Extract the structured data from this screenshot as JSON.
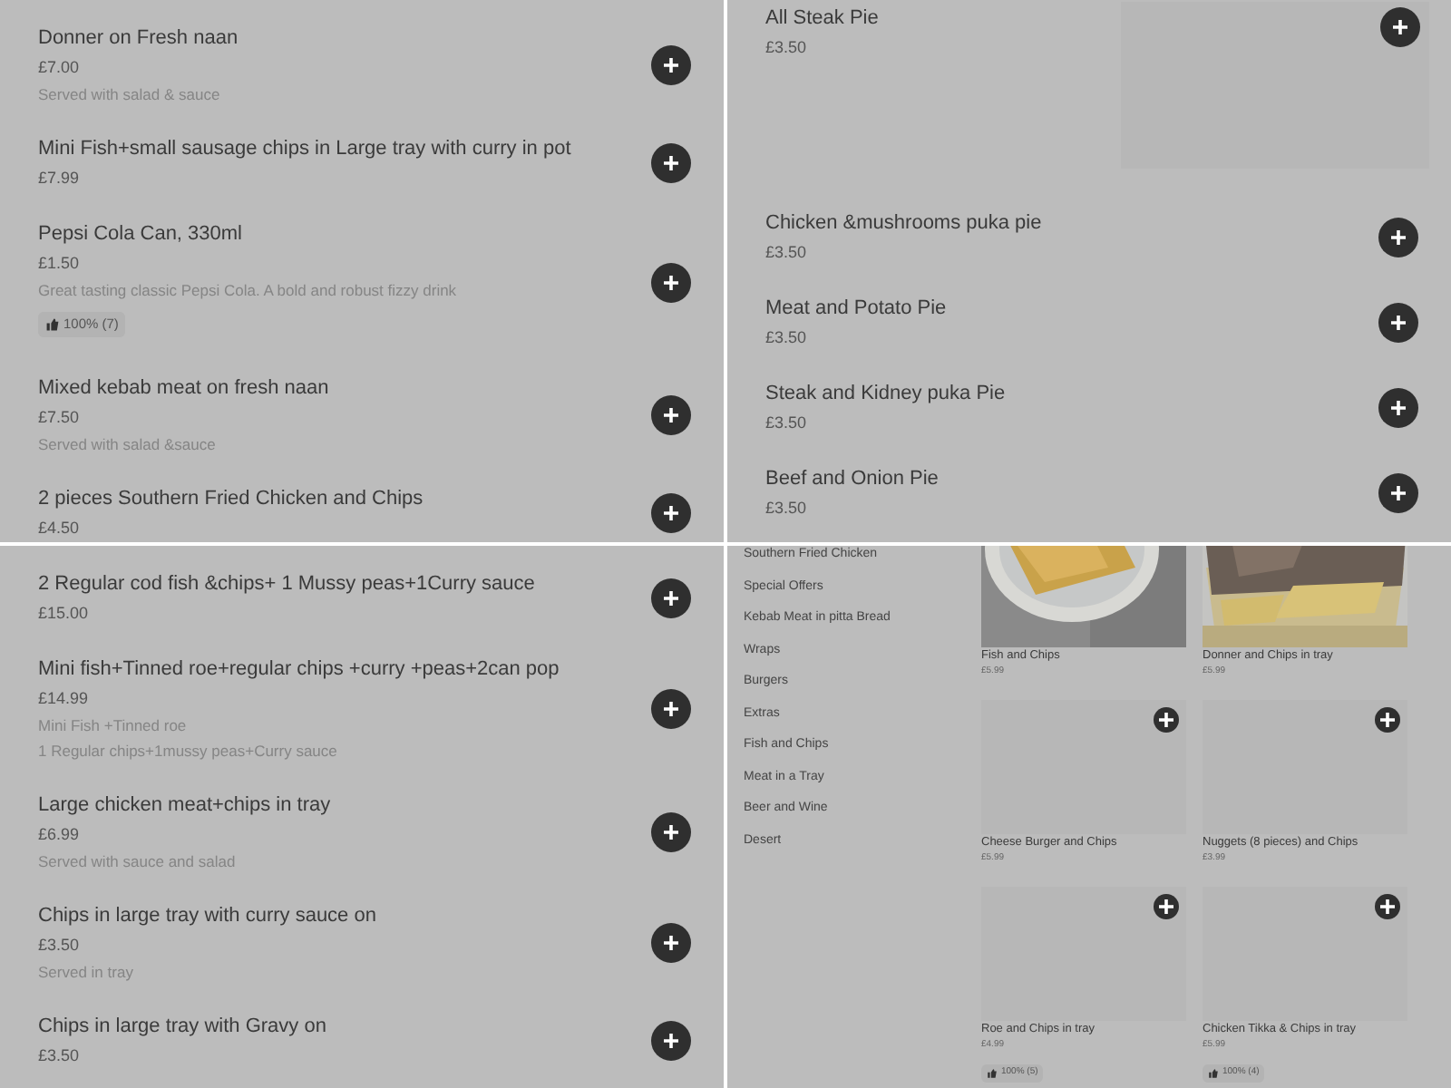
{
  "panels": [
    {
      "kind": "list",
      "items": [
        {
          "name": "Donner on Fresh naan",
          "price": "£7.00",
          "description": [
            "Served with salad & sauce"
          ]
        },
        {
          "name": "Mini Fish+small sausage chips in Large tray with curry in pot",
          "price": "£7.99"
        },
        {
          "name": "Pepsi Cola Can, 330ml",
          "price": "£1.50",
          "description": [
            "Great tasting classic Pepsi Cola. A bold and robust fizzy drink"
          ],
          "rating": "100% (7)"
        },
        {
          "name": "Mixed kebab meat on fresh naan",
          "price": "£7.50",
          "description": [
            "Served with salad &sauce"
          ]
        },
        {
          "name": "2 pieces Southern Fried Chicken and Chips",
          "price": "£4.50"
        }
      ]
    },
    {
      "kind": "list",
      "items": [
        {
          "kind": "with_image",
          "name": "All Steak Pie",
          "price": "£3.50"
        },
        {
          "kind": "plain",
          "name": "Chicken &mushrooms puka pie",
          "price": "£3.50"
        },
        {
          "kind": "plain",
          "name": "Meat and Potato Pie",
          "price": "£3.50"
        },
        {
          "kind": "plain",
          "name": "Steak and Kidney puka Pie",
          "price": "£3.50"
        },
        {
          "kind": "plain",
          "name": "Beef and Onion Pie",
          "price": "£3.50"
        }
      ]
    },
    {
      "kind": "list",
      "items": [
        {
          "name": "2 Regular cod fish &chips+ 1 Mussy peas+1Curry sauce",
          "price": "£15.00"
        },
        {
          "name": "Mini fish+Tinned roe+regular chips +curry +peas+2can pop",
          "price": "£14.99",
          "description": [
            "Mini Fish +Tinned roe",
            "1 Regular chips+1mussy peas+Curry sauce"
          ]
        },
        {
          "name": "Large chicken meat+chips in tray",
          "price": "£6.99",
          "description": [
            "Served with sauce and salad"
          ]
        },
        {
          "name": "Chips in large tray with curry sauce on",
          "price": "£3.50",
          "description": [
            "Served in tray"
          ]
        },
        {
          "name": "Chips in large tray with Gravy on",
          "price": "£3.50"
        }
      ]
    },
    {
      "kind": "grid",
      "categories": [
        "Southern Fried Chicken",
        "Special Offers",
        "Kebab Meat in pitta Bread",
        "Wraps",
        "Burgers",
        "Extras",
        "Fish and Chips",
        "Meat in a Tray",
        "Beer and Wine",
        "Desert"
      ],
      "cards": [
        {
          "name": "Fish and Chips",
          "price": "£5.99"
        },
        {
          "name": "Donner and Chips in tray",
          "price": "£5.99"
        },
        {
          "kind": "placeholder",
          "name": "Cheese Burger and Chips",
          "price": "£5.99"
        },
        {
          "kind": "placeholder",
          "name": "Nuggets (8 pieces) and Chips",
          "price": "£3.99"
        },
        {
          "kind": "placeholder",
          "name": "Roe and Chips in tray",
          "price": "£4.99",
          "rating": "100% (5)"
        },
        {
          "kind": "placeholder",
          "name": "Chicken Tikka & Chips in tray",
          "price": "£5.99",
          "rating": "100% (4)"
        }
      ]
    }
  ]
}
